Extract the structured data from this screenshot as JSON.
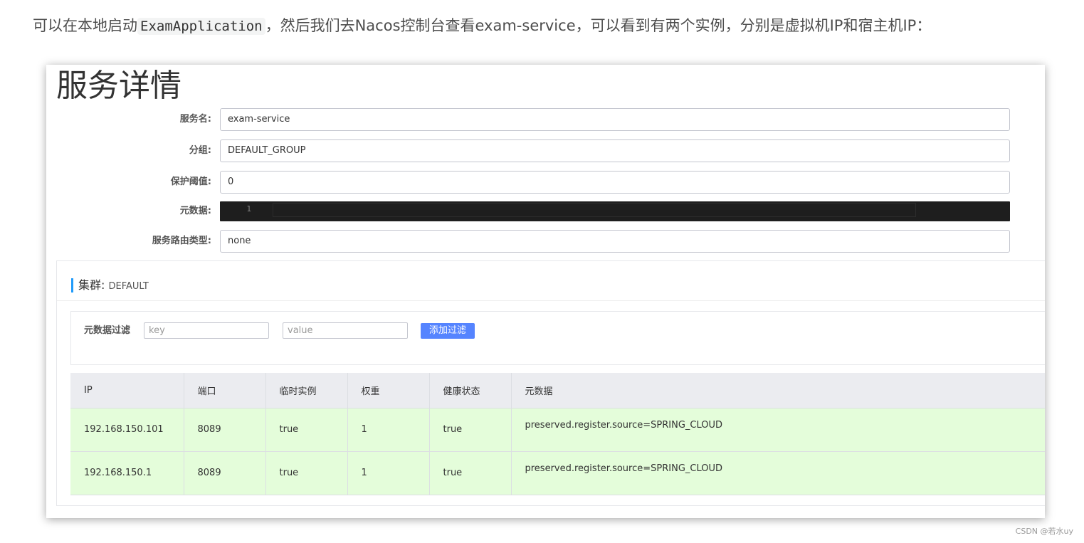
{
  "article": {
    "intro_before": "可以在本地启动",
    "intro_code": "ExamApplication",
    "intro_after": "，然后我们去Nacos控制台查看exam-service，可以看到有两个实例，分别是虚拟机IP和宿主机IP："
  },
  "panel": {
    "title": "服务详情",
    "fields": {
      "service_name_label": "服务名:",
      "service_name_value": "exam-service",
      "group_label": "分组:",
      "group_value": "DEFAULT_GROUP",
      "threshold_label": "保护阈值:",
      "threshold_value": "0",
      "metadata_label": "元数据:",
      "metadata_line_number": "1",
      "route_type_label": "服务路由类型:",
      "route_type_value": "none"
    },
    "cluster": {
      "label": "集群:",
      "name": "DEFAULT",
      "filter_label": "元数据过滤",
      "key_placeholder": "key",
      "value_placeholder": "value",
      "add_filter_button": "添加过滤"
    },
    "table": {
      "headers": [
        "IP",
        "端口",
        "临时实例",
        "权重",
        "健康状态",
        "元数据"
      ],
      "rows": [
        [
          "192.168.150.101",
          "8089",
          "true",
          "1",
          "true",
          "preserved.register.source=SPRING_CLOUD"
        ],
        [
          "192.168.150.1",
          "8089",
          "true",
          "1",
          "true",
          "preserved.register.source=SPRING_CLOUD"
        ]
      ],
      "row_color": "#e4fdda"
    }
  },
  "watermark": "CSDN @若水uy",
  "colors": {
    "accent": "#5584ff",
    "cluster_bar": "#209bfa",
    "healthy_row": "#e4fdda"
  }
}
